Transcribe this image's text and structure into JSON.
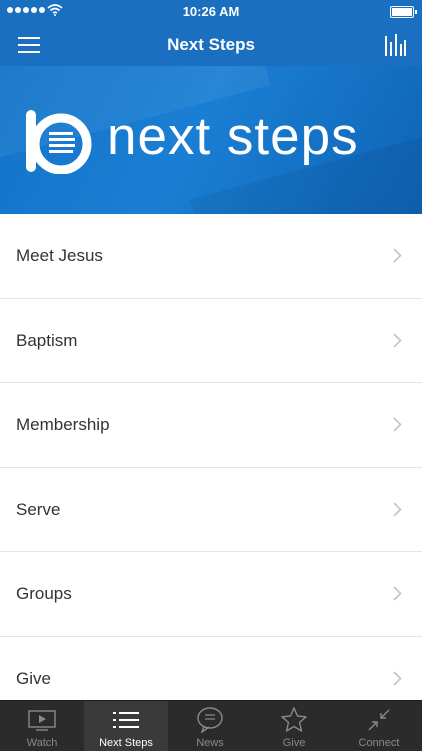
{
  "status_bar": {
    "time": "10:26 AM"
  },
  "nav": {
    "title": "Next Steps"
  },
  "banner": {
    "logo_text": "next steps"
  },
  "list": [
    {
      "label": "Meet Jesus"
    },
    {
      "label": "Baptism"
    },
    {
      "label": "Membership"
    },
    {
      "label": "Serve"
    },
    {
      "label": "Groups"
    },
    {
      "label": "Give"
    }
  ],
  "tabs": [
    {
      "label": "Watch",
      "icon": "video-icon"
    },
    {
      "label": "Next Steps",
      "icon": "list-icon",
      "active": true
    },
    {
      "label": "News",
      "icon": "speech-bubble-icon"
    },
    {
      "label": "Give",
      "icon": "star-icon"
    },
    {
      "label": "Connect",
      "icon": "collapse-arrows-icon"
    }
  ],
  "colors": {
    "brand_blue": "#1a6fc0",
    "tab_bar": "#2b2b2b"
  }
}
